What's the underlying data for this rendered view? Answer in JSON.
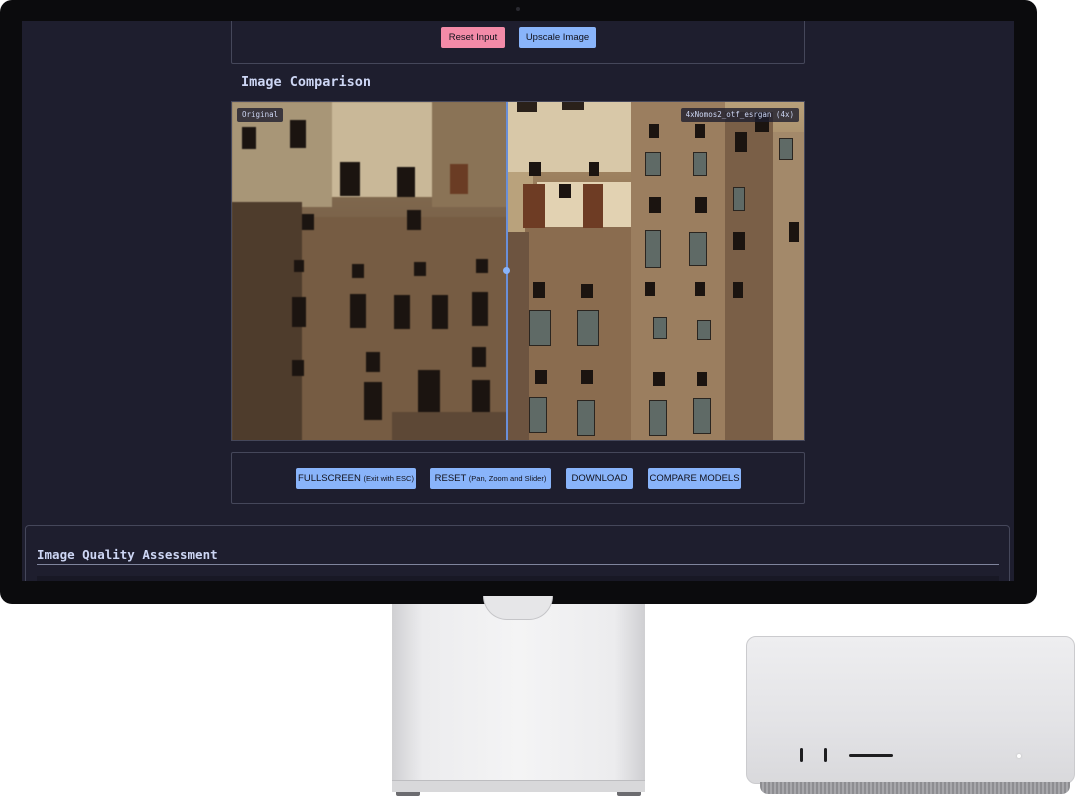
{
  "top_panel": {
    "reset_input_label": "Reset Input",
    "upscale_label": "Upscale Image"
  },
  "comparison": {
    "title": "Image Comparison",
    "left_label": "Original",
    "right_label": "4xNomos2_otf_esrgan (4x)",
    "slider_position": 0.48
  },
  "controls": {
    "fullscreen_label": "FULLSCREEN",
    "fullscreen_hint": "(Exit with ESC)",
    "reset_label": "RESET",
    "reset_hint": "(Pan, Zoom and Slider)",
    "download_label": "DOWNLOAD",
    "compare_label": "COMPARE MODELS"
  },
  "quality": {
    "title": "Image Quality Assessment"
  },
  "colors": {
    "background": "#1e1e2e",
    "primary_button": "#89b4fa",
    "danger_button": "#f38ba8",
    "text": "#cdd6f4",
    "border": "#45475a"
  }
}
